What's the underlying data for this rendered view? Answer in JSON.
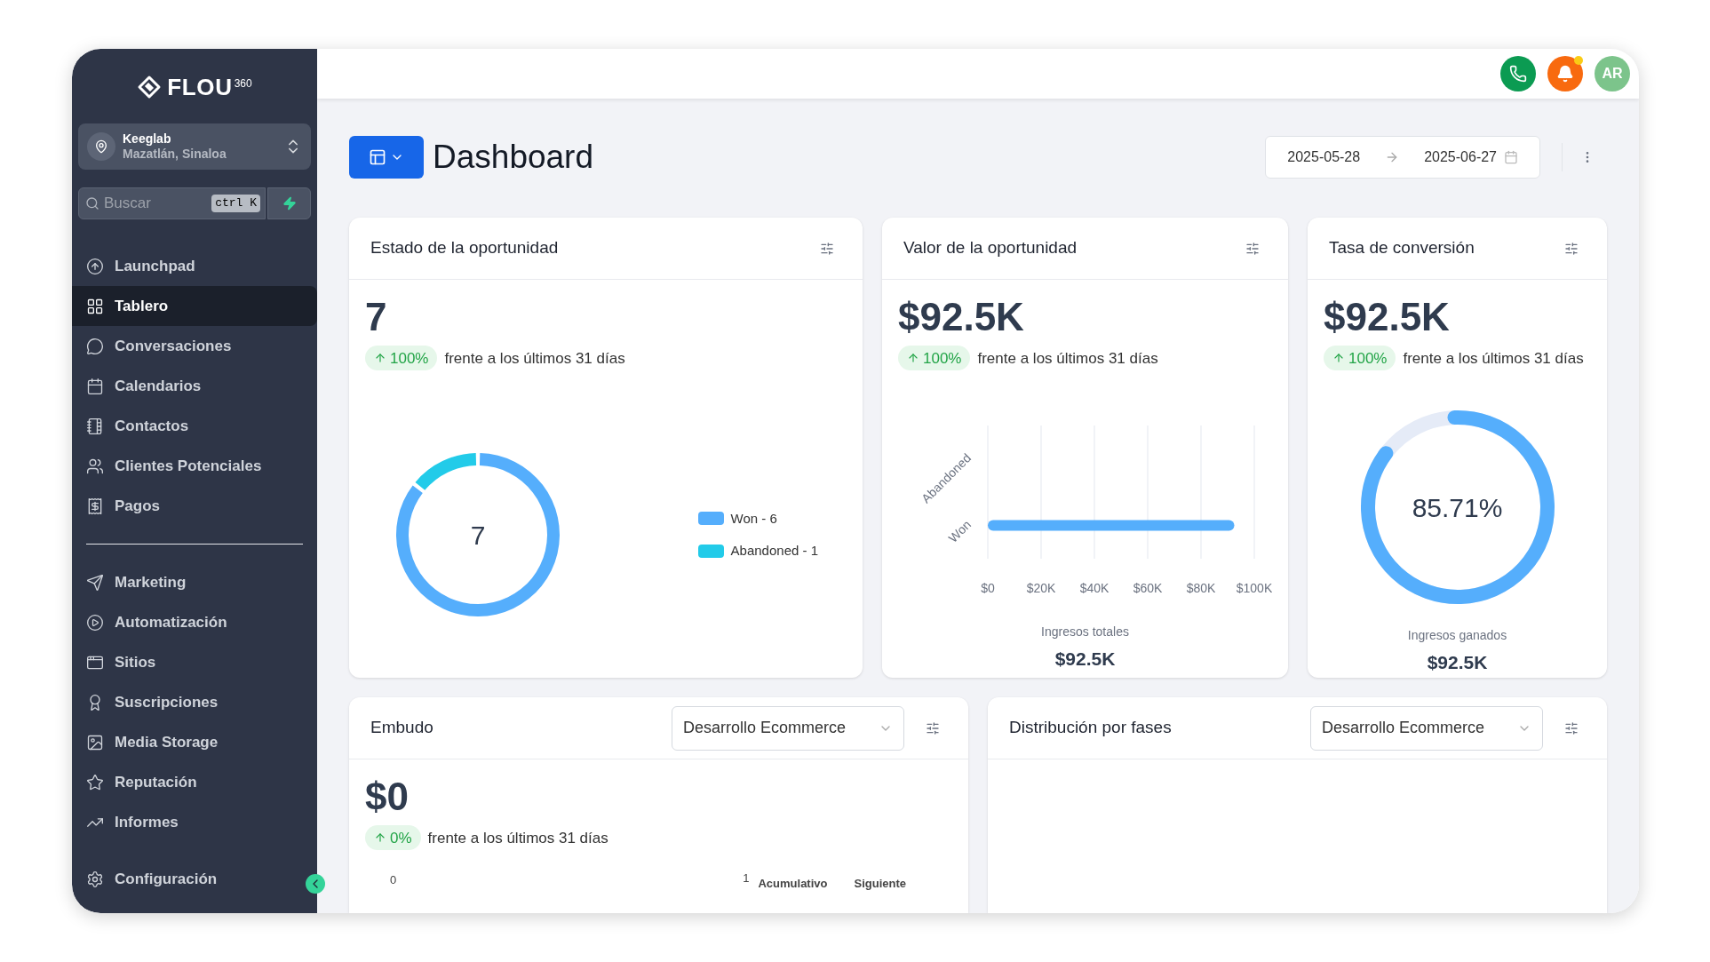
{
  "brand": {
    "name": "FLOU",
    "superscript": "360"
  },
  "account": {
    "name": "Keeglab",
    "location": "Mazatlán, Sinaloa"
  },
  "search": {
    "placeholder": "Buscar",
    "shortcut": "ctrl K"
  },
  "nav_groups": [
    [
      {
        "label": "Launchpad",
        "selected": false
      },
      {
        "label": "Tablero",
        "selected": true
      },
      {
        "label": "Conversaciones",
        "selected": false
      },
      {
        "label": "Calendarios",
        "selected": false
      },
      {
        "label": "Contactos",
        "selected": false
      },
      {
        "label": "Clientes Potenciales",
        "selected": false
      },
      {
        "label": "Pagos",
        "selected": false
      }
    ],
    [
      {
        "label": "Marketing",
        "selected": false
      },
      {
        "label": "Automatización",
        "selected": false
      },
      {
        "label": "Sitios",
        "selected": false
      },
      {
        "label": "Suscripciones",
        "selected": false
      },
      {
        "label": "Media Storage",
        "selected": false
      },
      {
        "label": "Reputación",
        "selected": false
      },
      {
        "label": "Informes",
        "selected": false
      }
    ]
  ],
  "settings_item": {
    "label": "Configuración",
    "selected": false
  },
  "header": {
    "notifications_unread": true,
    "avatar_initials": "AR"
  },
  "page": {
    "title": "Dashboard",
    "date_from": "2025-05-28",
    "date_to": "2025-06-27"
  },
  "cards": [
    {
      "kind": "chart",
      "title": "Estado de la oportunidad",
      "value": "7",
      "change": "100%",
      "note": "frente a los últimos 31 días",
      "center_label": "7",
      "chart_data": {
        "type": "donut",
        "categories": [
          "Won - 6",
          "Abandoned - 1"
        ],
        "series": [
          {
            "values": [
              85.71,
              14.29
            ]
          }
        ],
        "legend": "right",
        "colors": [
          "#55aefc",
          "#22cbe9"
        ]
      }
    },
    {
      "kind": "chart",
      "title": "Valor de la oportunidad",
      "value": "$92.5K",
      "change": "100%",
      "note": "frente a los últimos 31 días",
      "footer_label": "Ingresos totales",
      "footer_value": "$92.5K",
      "chart_data": {
        "type": "bar",
        "orientation": "horizontal",
        "grid": true,
        "categories": [
          "Abandoned",
          "Won"
        ],
        "series": [
          {
            "color": "#55aefc",
            "values": [
              0,
              92500
            ]
          }
        ],
        "xlim": [
          0,
          100000
        ],
        "xticks": [
          {
            "value": 0,
            "label": "$0"
          },
          {
            "value": 20000,
            "label": "$20K"
          },
          {
            "value": 40000,
            "label": "$40K"
          },
          {
            "value": 60000,
            "label": "$60K"
          },
          {
            "value": 80000,
            "label": "$80K"
          },
          {
            "value": 100000,
            "label": "$100K"
          }
        ]
      }
    },
    {
      "kind": "gauge",
      "title": "Tasa de conversión",
      "value": "$92.5K",
      "change": "100%",
      "note": "frente a los últimos 31 días",
      "level": 0.8571,
      "center_label": "85.71%",
      "footer_label": "Ingresos ganados",
      "footer_value": "$92.5K"
    },
    {
      "kind": "funnel",
      "title": "Embudo",
      "dropdown": "Desarrollo Ecommerce",
      "value": "$0",
      "change": "0%",
      "note": "frente a los últimos 31 días",
      "axis_labels": [
        "0",
        "1"
      ],
      "columns": [
        "Acumulativo",
        "Siguiente"
      ]
    },
    {
      "kind": "empty",
      "title": "Distribución por fases",
      "dropdown": "Desarrollo Ecommerce"
    }
  ]
}
